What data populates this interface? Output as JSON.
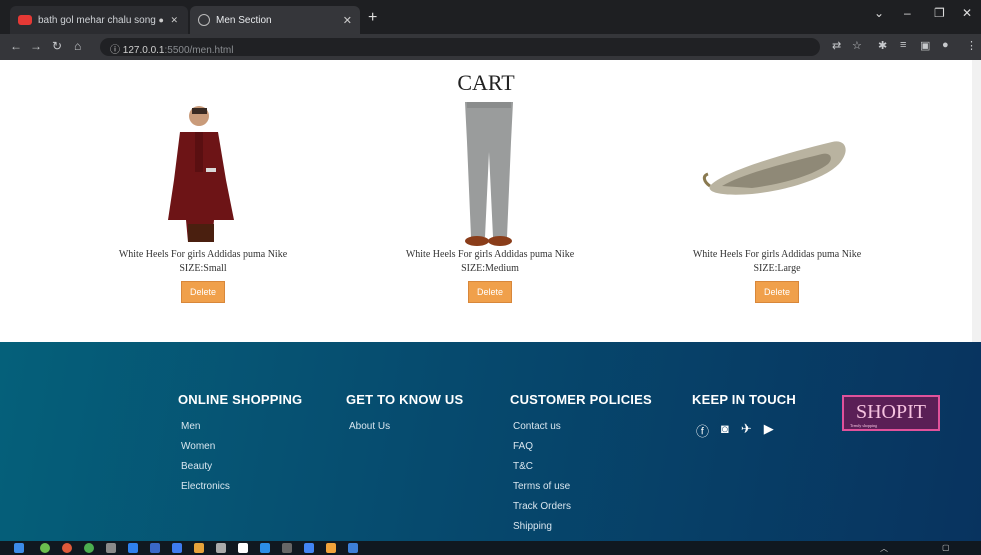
{
  "browser": {
    "tabs": [
      {
        "label": "bath gol mehar chalu song"
      },
      {
        "label": "Men Section"
      }
    ],
    "new_tab": "+",
    "url_host": "127.0.0.1",
    "url_rest": ":5500/men.html",
    "window_controls": [
      "⌄",
      "–",
      "❐",
      "✕"
    ]
  },
  "cart": {
    "title": "CART",
    "items": [
      {
        "name": "White Heels For girls Addidas puma Nike",
        "size": "SIZE:Small",
        "button": "Delete"
      },
      {
        "name": "White Heels For girls Addidas puma Nike",
        "size": "SIZE:Medium",
        "button": "Delete"
      },
      {
        "name": "White Heels For girls Addidas puma Nike",
        "size": "SIZE:Large",
        "button": "Delete"
      }
    ]
  },
  "footer": {
    "online_shopping": {
      "heading": "ONLINE SHOPPING",
      "links": [
        "Men",
        "Women",
        "Beauty",
        "Electronics"
      ]
    },
    "know_us": {
      "heading": "GET TO KNOW US",
      "links": [
        "About Us"
      ]
    },
    "policies": {
      "heading": "CUSTOMER POLICIES",
      "links": [
        "Contact us",
        "FAQ",
        "T&C",
        "Terms of use",
        "Track Orders",
        "Shipping"
      ]
    },
    "keep_in_touch": {
      "heading": "KEEP IN TOUCH",
      "icons": [
        "facebook-icon",
        "instagram-icon",
        "twitter-icon",
        "youtube-icon"
      ]
    },
    "logo": {
      "text": "SHOPIT",
      "tagline": "Trendy shopping"
    }
  },
  "colors": {
    "accent": "#f0a04b",
    "footer_from": "#05607a",
    "footer_to": "#08335f"
  }
}
